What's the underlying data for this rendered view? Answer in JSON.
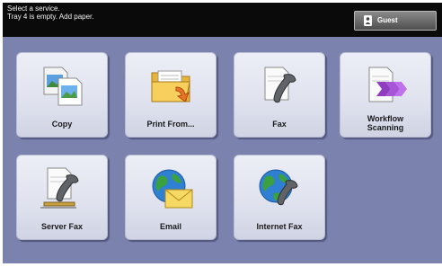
{
  "status": {
    "line1": "Select a service.",
    "line2": "Tray 4 is empty.  Add paper."
  },
  "user_button": {
    "label": "Guest",
    "icon": "person-icon"
  },
  "services": [
    {
      "label": "Copy",
      "icon": "copy-icon"
    },
    {
      "label": "Print From...",
      "icon": "print-from-folder-icon"
    },
    {
      "label": "Fax",
      "icon": "fax-icon"
    },
    {
      "label": "Workflow Scanning",
      "label_line1": "Workflow",
      "label_line2": "Scanning",
      "icon": "workflow-scanning-icon"
    },
    {
      "label": "Server Fax",
      "icon": "server-fax-icon"
    },
    {
      "label": "Email",
      "icon": "email-icon"
    },
    {
      "label": "Internet Fax",
      "icon": "internet-fax-icon"
    }
  ],
  "colors": {
    "status_bar": "#0a0a0a",
    "panel_background": "#7a82ad",
    "tile_background": "#e4e7f1"
  }
}
